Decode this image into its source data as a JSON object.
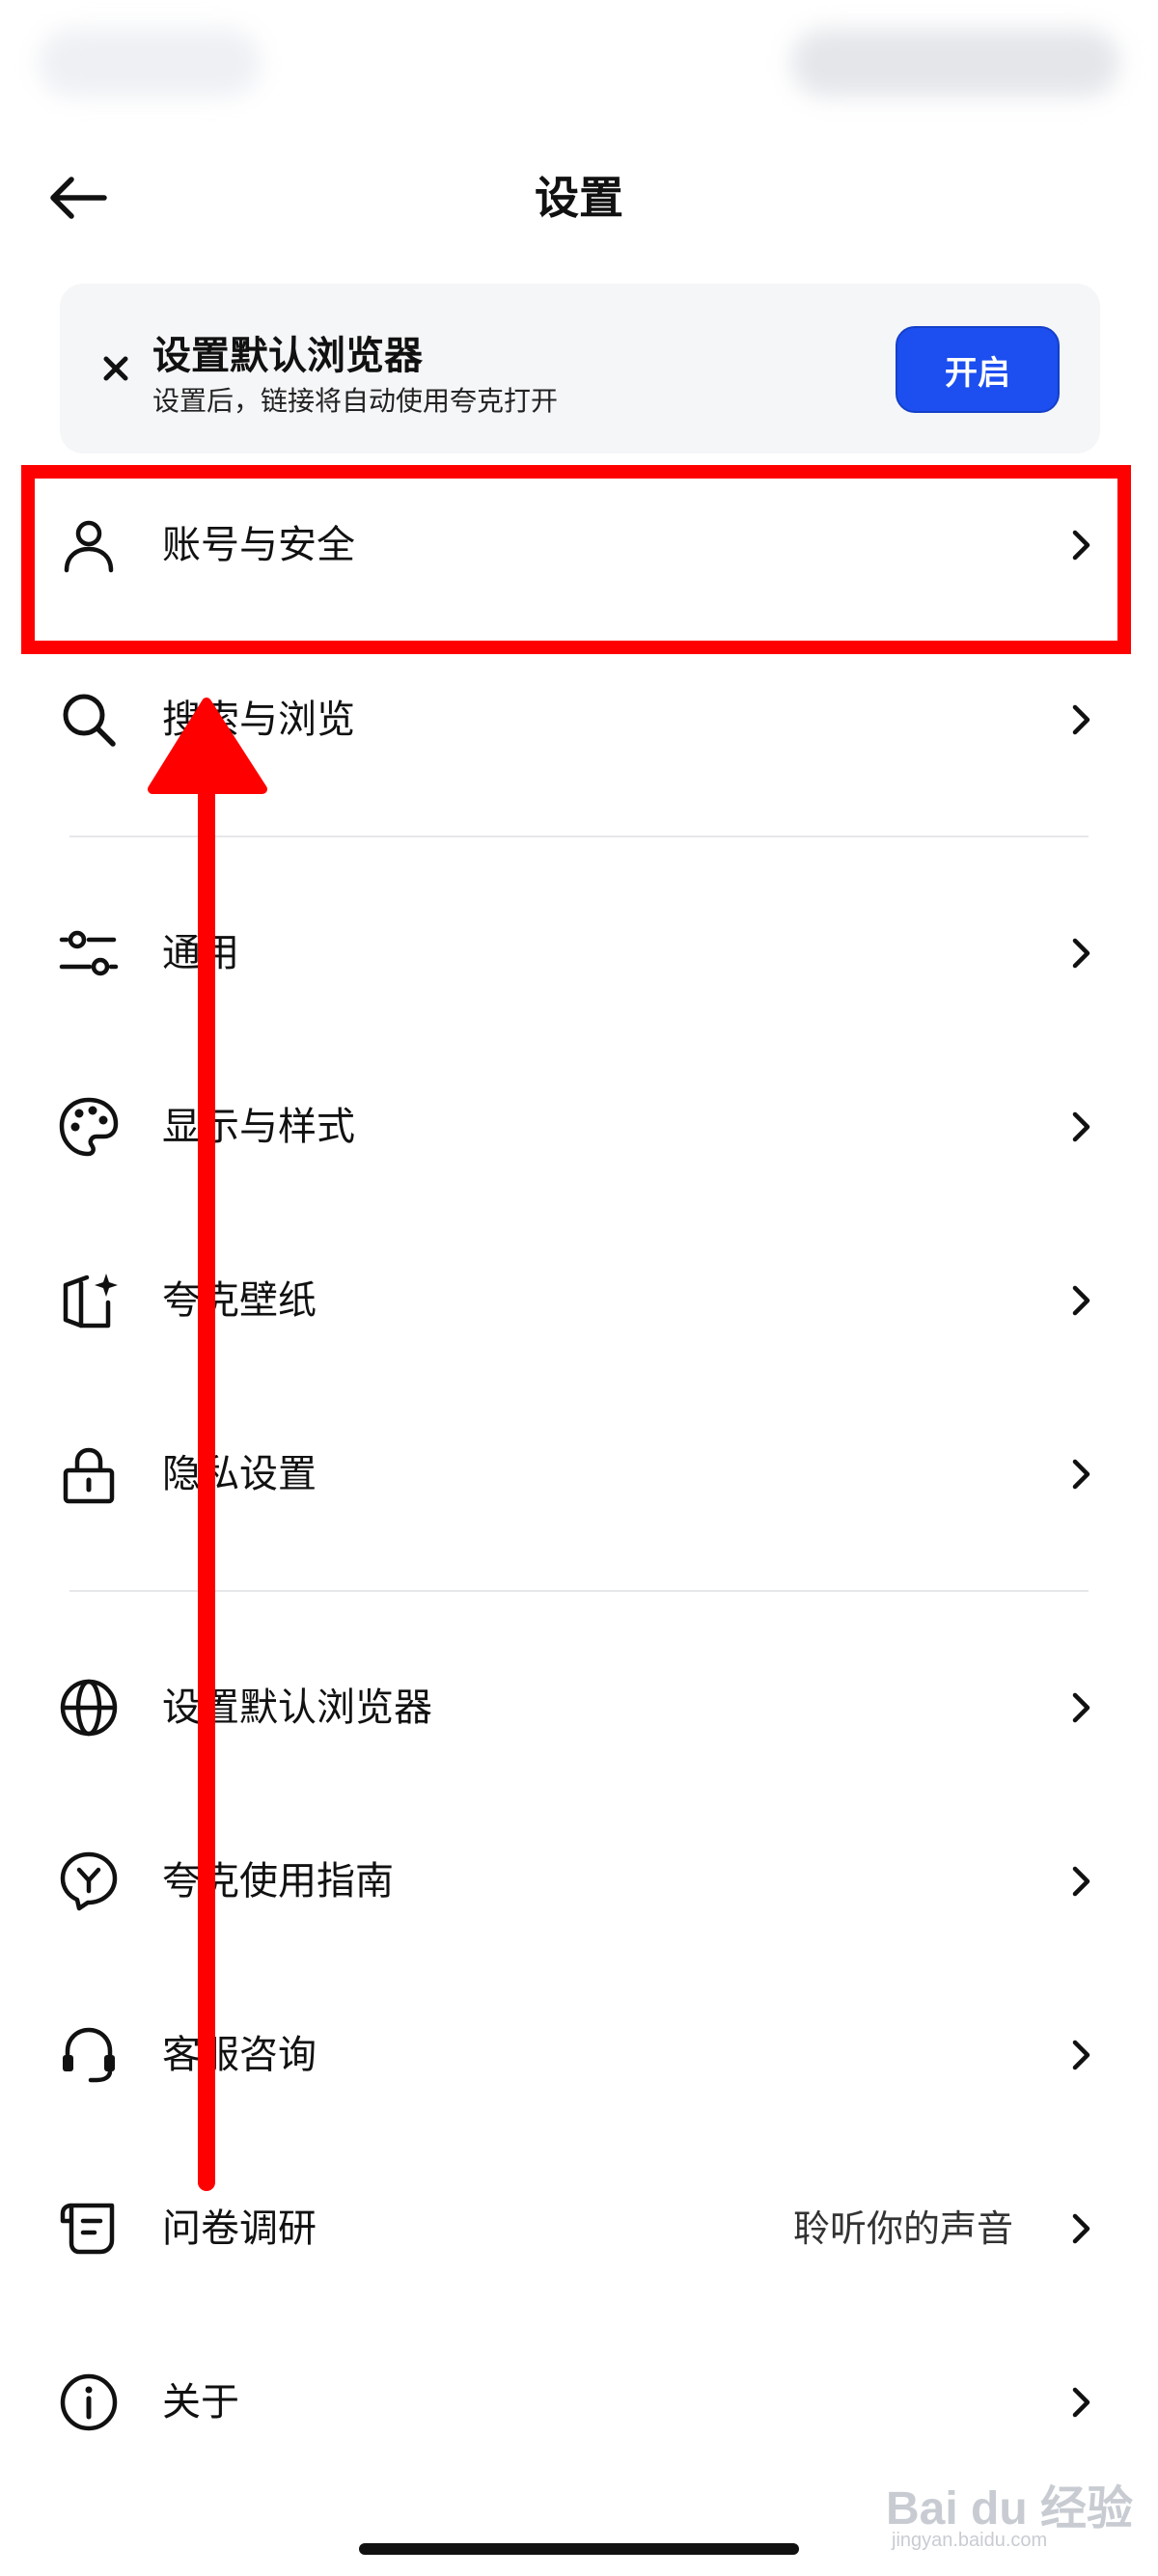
{
  "header": {
    "title": "设置"
  },
  "banner": {
    "title": "设置默认浏览器",
    "subtitle": "设置后，链接将自动使用夸克打开",
    "button_label": "开启"
  },
  "menu": {
    "items": [
      {
        "label": "账号与安全",
        "icon": "user-icon"
      },
      {
        "label": "搜索与浏览",
        "icon": "search-icon"
      },
      {
        "label": "通用",
        "icon": "sliders-icon"
      },
      {
        "label": "显示与样式",
        "icon": "palette-icon"
      },
      {
        "label": "夸克壁纸",
        "icon": "wallpaper-icon"
      },
      {
        "label": "隐私设置",
        "icon": "lock-icon"
      },
      {
        "label": "设置默认浏览器",
        "icon": "globe-icon"
      },
      {
        "label": "夸克使用指南",
        "icon": "guide-icon"
      },
      {
        "label": "客服咨询",
        "icon": "headset-icon"
      },
      {
        "label": "问卷调研",
        "icon": "survey-icon",
        "value": "聆听你的声音"
      },
      {
        "label": "关于",
        "icon": "info-icon"
      }
    ]
  },
  "annotation": {
    "color": "#ff0000"
  },
  "theme": {
    "accent": "#1c4ef0",
    "banner_bg": "#f5f6f8"
  },
  "watermark": {
    "main": "Bai du 经验",
    "sub": "jingyan.baidu.com"
  }
}
